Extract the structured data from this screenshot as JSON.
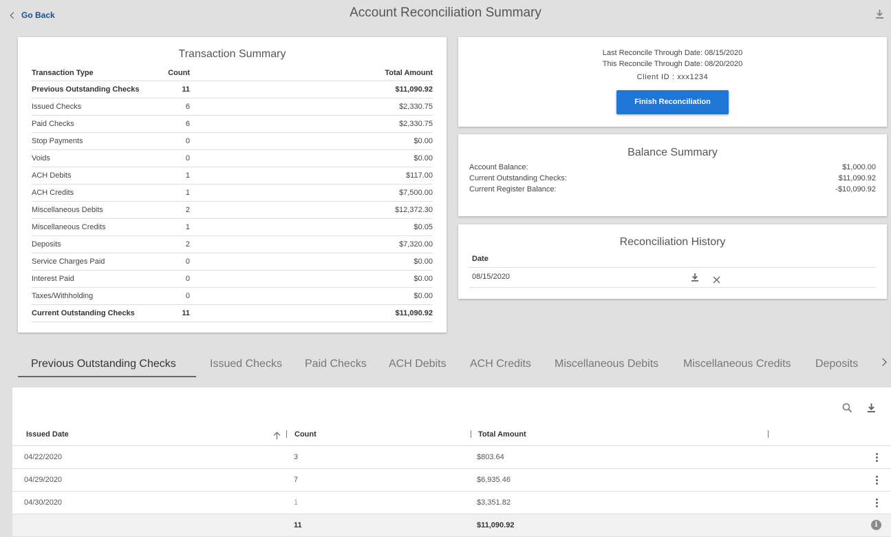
{
  "header": {
    "go_back": "Go Back",
    "title": "Account Reconciliation Summary"
  },
  "transaction_summary": {
    "title": "Transaction Summary",
    "columns": [
      "Transaction Type",
      "Count",
      "Total Amount"
    ],
    "rows": [
      {
        "type": "Previous Outstanding Checks",
        "count": "11",
        "total": "$11,090.92"
      },
      {
        "type": "Issued Checks",
        "count": "6",
        "total": "$2,330.75"
      },
      {
        "type": "Paid Checks",
        "count": "6",
        "total": "$2,330.75"
      },
      {
        "type": "Stop Payments",
        "count": "0",
        "total": "$0.00"
      },
      {
        "type": "Voids",
        "count": "0",
        "total": "$0.00"
      },
      {
        "type": "ACH Debits",
        "count": "1",
        "total": "$117.00"
      },
      {
        "type": "ACH Credits",
        "count": "1",
        "total": "$7,500.00"
      },
      {
        "type": "Miscellaneous Debits",
        "count": "2",
        "total": "$12,372.30"
      },
      {
        "type": "Miscellaneous Credits",
        "count": "1",
        "total": "$0.05"
      },
      {
        "type": "Deposits",
        "count": "2",
        "total": "$7,320.00"
      },
      {
        "type": "Service Charges Paid",
        "count": "0",
        "total": "$0.00"
      },
      {
        "type": "Interest Paid",
        "count": "0",
        "total": "$0.00"
      },
      {
        "type": "Taxes/Withholding",
        "count": "0",
        "total": "$0.00"
      },
      {
        "type": "Current Outstanding Checks",
        "count": "11",
        "total": "$11,090.92"
      }
    ]
  },
  "reconcile": {
    "last_through": "Last Reconcile Through Date: 08/15/2020",
    "this_through": "This Reconcile Through Date: 08/20/2020",
    "client_id": "Client ID : xxx1234",
    "finish_button": "Finish Reconciliation",
    "accent_color": "#1e76d6"
  },
  "balance_summary": {
    "title": "Balance Summary",
    "rows": [
      {
        "label": "Account Balance:",
        "value": "$1,000.00"
      },
      {
        "label": "Current Outstanding Checks:",
        "value": "$11,090.92"
      },
      {
        "label": "Current Register Balance:",
        "value": "-$10,090.92"
      }
    ]
  },
  "history": {
    "title": "Reconciliation History",
    "column": "Date",
    "rows": [
      {
        "date": "08/15/2020"
      }
    ],
    "icons": [
      "download-icon",
      "close-icon"
    ]
  },
  "tabs": [
    {
      "label": "Previous Outstanding Checks",
      "active": true
    },
    {
      "label": "Issued Checks"
    },
    {
      "label": "Paid Checks"
    },
    {
      "label": "ACH Debits"
    },
    {
      "label": "ACH Credits"
    },
    {
      "label": "Miscellaneous Debits"
    },
    {
      "label": "Miscellaneous Credits"
    },
    {
      "label": "Deposits"
    }
  ],
  "grid": {
    "columns": [
      "Issued Date",
      "Count",
      "Total Amount"
    ],
    "sort": "ascending",
    "rows": [
      {
        "date": "04/22/2020",
        "count": "3",
        "total": "$803.64"
      },
      {
        "date": "04/29/2020",
        "count": "7",
        "total": "$6,935.46"
      },
      {
        "date": "04/30/2020",
        "count": "1",
        "total": "$3,351.82"
      }
    ],
    "totals": {
      "count": "11",
      "total": "$11,090.92"
    },
    "icons": [
      "search-icon",
      "download-icon",
      "more-vertical-icon",
      "info-icon"
    ]
  }
}
